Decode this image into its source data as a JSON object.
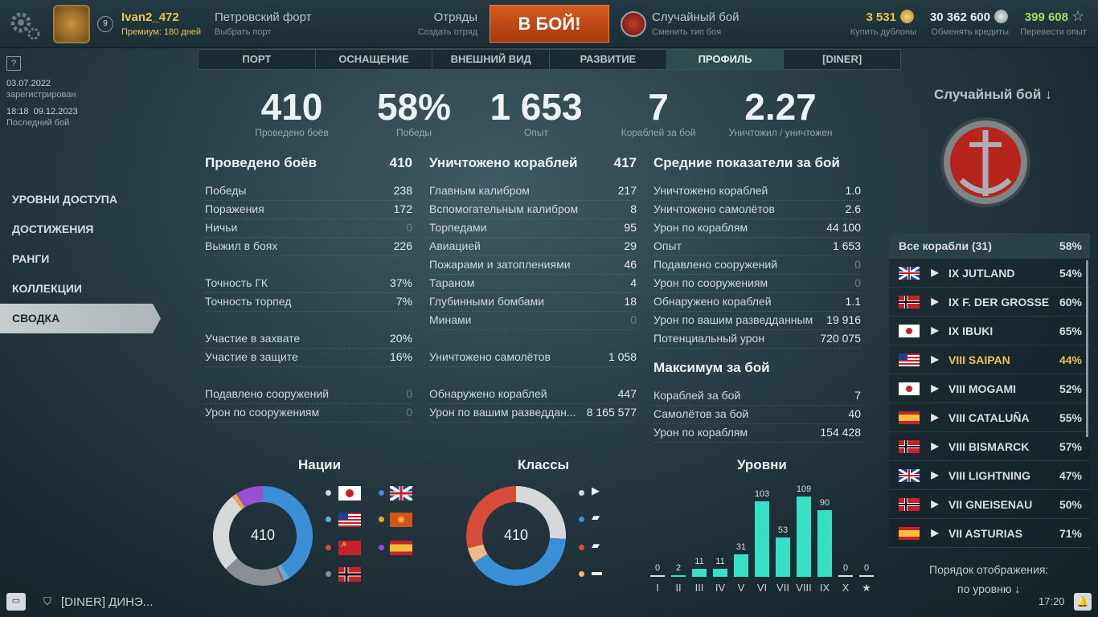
{
  "topbar": {
    "username": "Ivan2_472",
    "level": "9",
    "premium": "Премиум: 180 дней",
    "port_name": "Петровский форт",
    "port_sub": "Выбрать порт",
    "squads": "Отряды",
    "squads_sub": "Создать отряд",
    "battle_button": "В БОЙ!",
    "mode": "Случайный бой",
    "mode_sub": "Сменить тип боя",
    "doubloons": "3 531",
    "doubloons_sub": "Купить дублоны",
    "credits": "30 362 600",
    "credits_sub": "Обменять кредиты",
    "xp": "399 608",
    "xp_sub": "Перевести опыт"
  },
  "tabs": [
    "ПОРТ",
    "ОСНАЩЕНИЕ",
    "ВНЕШНИЙ ВИД",
    "РАЗВИТИЕ",
    "ПРОФИЛЬ",
    "[DINER]"
  ],
  "account": {
    "reg_date": "03.07.2022",
    "reg_label": "зарегистрирован",
    "last_date": "18:18  09.12.2023",
    "last_label": "Последний бой"
  },
  "sidebar": [
    "УРОВНИ ДОСТУПА",
    "ДОСТИЖЕНИЯ",
    "РАНГИ",
    "КОЛЛЕКЦИИ",
    "СВОДКА"
  ],
  "summary": [
    {
      "value": "410",
      "label": "Проведено боёв"
    },
    {
      "value": "58%",
      "label": "Победы"
    },
    {
      "value": "1 653",
      "label": "Опыт"
    },
    {
      "value": "7",
      "label": "Кораблей за бой"
    },
    {
      "value": "2.27",
      "label": "Уничтожил / уничтожен"
    }
  ],
  "battles": {
    "title": "Проведено боёв",
    "total": "410",
    "rows": [
      {
        "label": "Победы",
        "value": "238"
      },
      {
        "label": "Поражения",
        "value": "172"
      },
      {
        "label": "Ничьи",
        "value": "0"
      },
      {
        "label": "Выжил в боях",
        "value": "226"
      },
      {
        "label": "",
        "value": ""
      },
      {
        "label": "Точность ГК",
        "value": "37%"
      },
      {
        "label": "Точность торпед",
        "value": "7%"
      },
      {
        "label": "",
        "value": ""
      },
      {
        "label": "Участие в захвате",
        "value": "20%"
      },
      {
        "label": "Участие в защите",
        "value": "16%"
      },
      {
        "label": "",
        "value": ""
      },
      {
        "label": "Подавлено сооружений",
        "value": "0"
      },
      {
        "label": "Урон по сооружениям",
        "value": "0"
      }
    ]
  },
  "destroyed": {
    "title": "Уничтожено кораблей",
    "total": "417",
    "rows": [
      {
        "label": "Главным калибром",
        "value": "217"
      },
      {
        "label": "Вспомогательным калибром",
        "value": "8"
      },
      {
        "label": "Торпедами",
        "value": "95"
      },
      {
        "label": "Авиацией",
        "value": "29"
      },
      {
        "label": "Пожарами и затоплениями",
        "value": "46"
      },
      {
        "label": "Тараном",
        "value": "4"
      },
      {
        "label": "Глубинными бомбами",
        "value": "18"
      },
      {
        "label": "Минами",
        "value": "0"
      },
      {
        "label": "",
        "value": ""
      },
      {
        "label": "Уничтожено самолётов",
        "value": "1 058"
      },
      {
        "label": "",
        "value": ""
      },
      {
        "label": "Обнаружено кораблей",
        "value": "447"
      },
      {
        "label": "Урон по вашим разведдан...",
        "value": "8 165 577"
      }
    ]
  },
  "averages": {
    "title": "Средние показатели за бой",
    "rows": [
      {
        "label": "Уничтожено кораблей",
        "value": "1.0"
      },
      {
        "label": "Уничтожено самолётов",
        "value": "2.6"
      },
      {
        "label": "Урон по кораблям",
        "value": "44 100"
      },
      {
        "label": "Опыт",
        "value": "1 653"
      },
      {
        "label": "Подавлено сооружений",
        "value": "0"
      },
      {
        "label": "Урон по сооружениям",
        "value": "0"
      },
      {
        "label": "Обнаружено кораблей",
        "value": "1.1"
      },
      {
        "label": "Урон по вашим разведданным",
        "value": "19 916"
      },
      {
        "label": "Потенциальный урон",
        "value": "720 075"
      }
    ],
    "max_title": "Максимум за бой",
    "max_rows": [
      {
        "label": "Кораблей за бой",
        "value": "7"
      },
      {
        "label": "Самолётов за бой",
        "value": "40"
      },
      {
        "label": "Урон по кораблям",
        "value": "154 428"
      }
    ]
  },
  "right": {
    "mode": "Случайный бой ↓",
    "all_ships": "Все корабли (31)",
    "all_pct": "58%",
    "ships": [
      {
        "name": "IX JUTLAND",
        "pct": "54%",
        "flag": "uk",
        "premium": false
      },
      {
        "name": "IX F. DER GROSSE",
        "pct": "60%",
        "flag": "de",
        "premium": false
      },
      {
        "name": "IX IBUKI",
        "pct": "65%",
        "flag": "jp",
        "premium": false
      },
      {
        "name": "VIII SAIPAN",
        "pct": "44%",
        "flag": "us",
        "premium": true
      },
      {
        "name": "VIII MOGAMI",
        "pct": "52%",
        "flag": "jp",
        "premium": false
      },
      {
        "name": "VIII CATALUÑA",
        "pct": "55%",
        "flag": "es",
        "premium": false
      },
      {
        "name": "VIII BISMARCK",
        "pct": "57%",
        "flag": "de",
        "premium": false
      },
      {
        "name": "VIII LIGHTNING",
        "pct": "47%",
        "flag": "uk",
        "premium": false
      },
      {
        "name": "VII GNEISENAU",
        "pct": "50%",
        "flag": "de",
        "premium": false
      },
      {
        "name": "VII ASTURIAS",
        "pct": "71%",
        "flag": "es",
        "premium": false
      }
    ],
    "sort_label": "Порядок отображения:",
    "sort_value": "по уровню ↓"
  },
  "charts": {
    "nations_title": "Нации",
    "classes_title": "Классы",
    "tiers_title": "Уровни",
    "nations_total": "410",
    "classes_total": "410"
  },
  "chart_data": [
    {
      "type": "pie",
      "title": "Нации",
      "center": "410",
      "slices": [
        {
          "name": "jp",
          "value": 0.41,
          "color": "#3a8fd6"
        },
        {
          "name": "us",
          "value": 0.02,
          "color": "#5aaee0"
        },
        {
          "name": "su",
          "value": 0.005,
          "color": "#d84a3a"
        },
        {
          "name": "de",
          "value": 0.2,
          "color": "#8a8f94"
        },
        {
          "name": "uk",
          "value": 0.26,
          "color": "#d6d8da"
        },
        {
          "name": "pa",
          "value": 0.015,
          "color": "#e3a93a"
        },
        {
          "name": "es",
          "value": 0.09,
          "color": "#9a4fd0"
        }
      ]
    },
    {
      "type": "pie",
      "title": "Классы",
      "center": "410",
      "slices": [
        {
          "name": "destroyer",
          "value": 0.26,
          "color": "#d6d8da"
        },
        {
          "name": "cruiser",
          "value": 0.4,
          "color": "#3a8fd6"
        },
        {
          "name": "battleship",
          "value": 0.05,
          "color": "#f0b888"
        },
        {
          "name": "carrier",
          "value": 0.29,
          "color": "#d84a3a"
        }
      ]
    },
    {
      "type": "bar",
      "title": "Уровни",
      "categories": [
        "I",
        "II",
        "III",
        "IV",
        "V",
        "VI",
        "VII",
        "VIII",
        "IX",
        "X",
        "★"
      ],
      "values": [
        0,
        2,
        11,
        11,
        31,
        103,
        53,
        109,
        90,
        0,
        0
      ],
      "color": "#35e0c4"
    }
  ],
  "footer": {
    "chat": "[DINER] ДИНЭ...",
    "time": "17:20"
  }
}
